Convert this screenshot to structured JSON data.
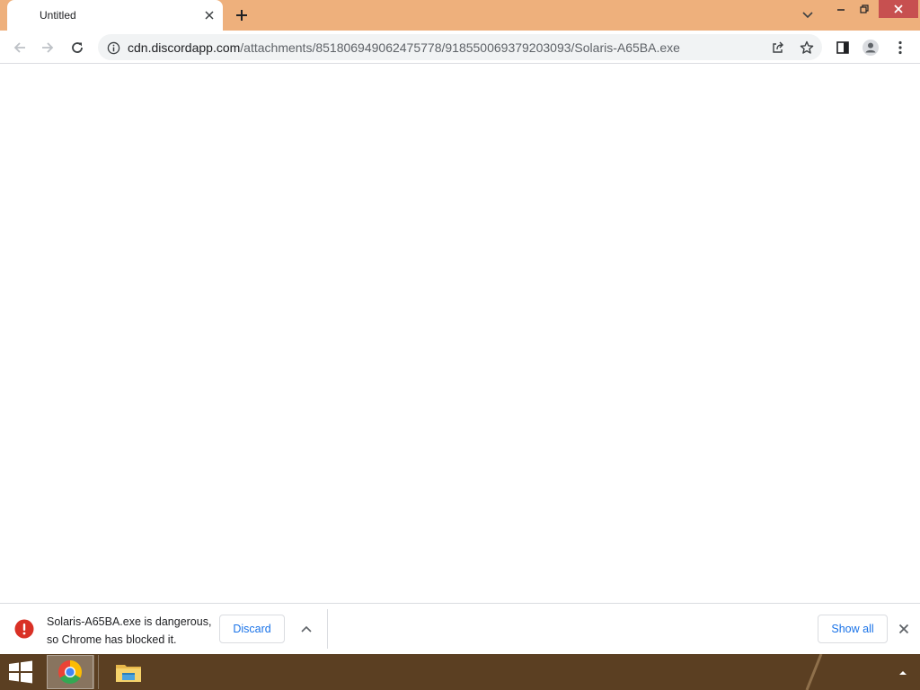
{
  "tab": {
    "title": "Untitled"
  },
  "address_bar": {
    "url_host": "cdn.discordapp.com",
    "url_path": "/attachments/851806949062475778/918550069379203093/Solaris-A65BA.exe"
  },
  "download_shelf": {
    "message_line1": "Solaris-A65BA.exe is dangerous,",
    "message_line2": "so Chrome has blocked it.",
    "discard_label": "Discard",
    "show_all_label": "Show all"
  },
  "icons": {
    "tab_close": "close-icon",
    "new_tab": "plus-icon",
    "tab_search": "chevron-down-icon",
    "minimize": "minimize-icon",
    "restore": "restore-icon",
    "window_close": "close-icon",
    "back": "arrow-left-icon",
    "forward": "arrow-right-icon",
    "reload": "reload-icon",
    "site_info": "info-icon",
    "share": "share-icon",
    "bookmark": "star-icon",
    "side_panel": "side-panel-icon",
    "profile": "person-icon",
    "menu": "kebab-menu-icon",
    "download_warning": "warning-icon",
    "download_menu": "chevron-up-icon",
    "shelf_close": "close-icon",
    "start": "windows-logo-icon",
    "chrome": "chrome-icon",
    "explorer": "folder-icon",
    "tray": "chevron-up-icon"
  },
  "colors": {
    "tabstrip": "#eeb07c",
    "accent_blue": "#1a73e8",
    "danger_red": "#d93025",
    "taskbar": "#5b3f22"
  }
}
